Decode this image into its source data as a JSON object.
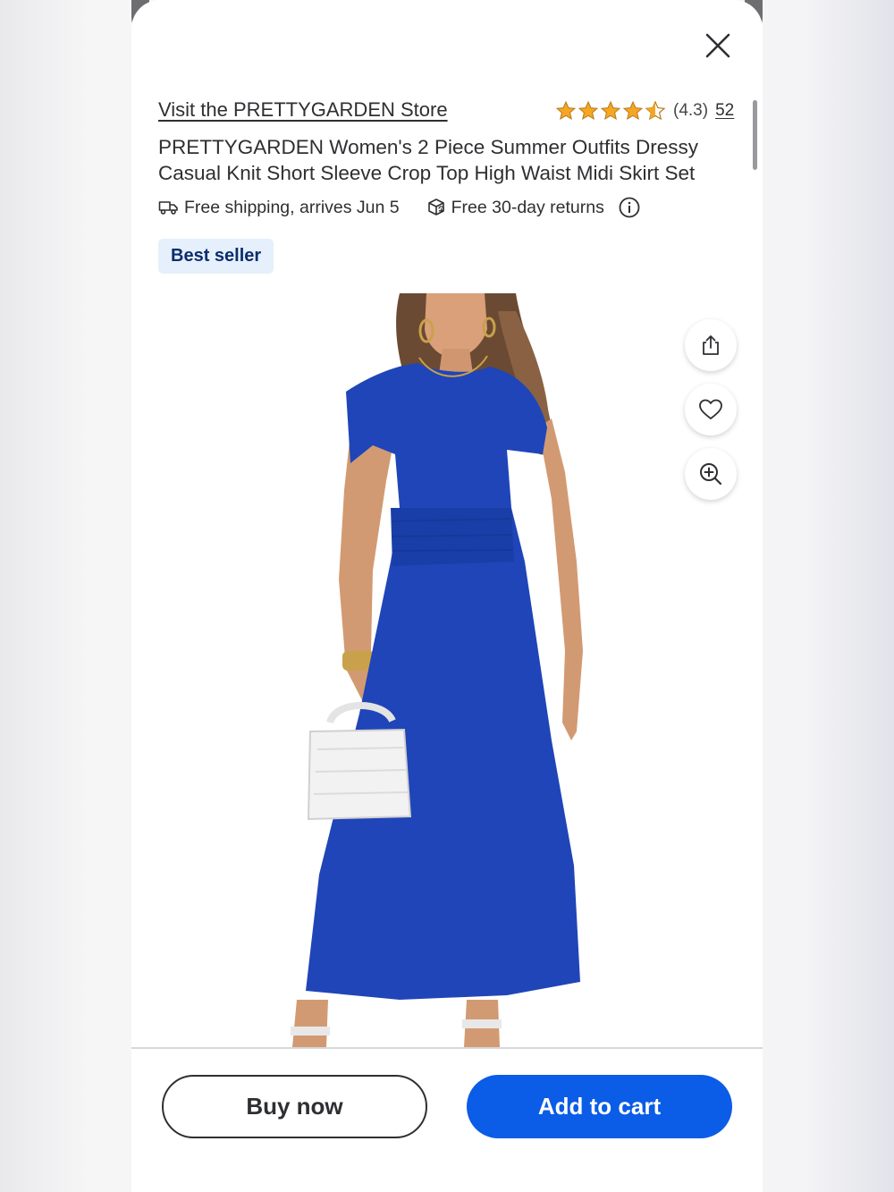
{
  "header": {
    "store_link": "Visit the PRETTYGARDEN Store",
    "rating_value": "(4.3)",
    "rating_count": "52",
    "rating_stars": 4.3
  },
  "product": {
    "title": "PRETTYGARDEN Women's 2 Piece Summer Outfits Dressy Casual Knit Short Sleeve Crop Top High Waist Midi Skirt Set",
    "badge": "Best seller",
    "dress_color": "#1f45b8"
  },
  "fulfillment": {
    "shipping": "Free shipping, arrives Jun 5",
    "returns": "Free 30-day returns"
  },
  "icons": {
    "close": "close-icon",
    "share": "share-icon",
    "favorite": "heart-icon",
    "zoom": "zoom-in-icon",
    "shipping": "truck-icon",
    "returns": "return-box-icon",
    "info": "info-icon"
  },
  "actions": {
    "buy_now": "Buy now",
    "add_to_cart": "Add to cart"
  },
  "colors": {
    "accent": "#0b5ce6",
    "badge_bg": "#e6f0fc",
    "badge_text": "#0b2e6b",
    "star": "#f5a623"
  }
}
